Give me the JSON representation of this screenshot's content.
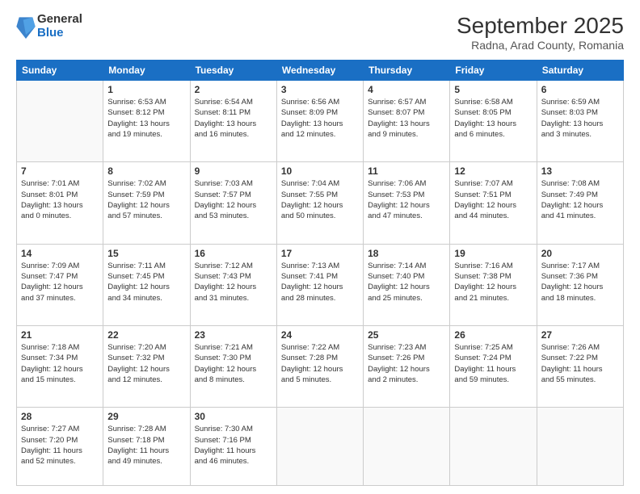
{
  "header": {
    "logo": {
      "general": "General",
      "blue": "Blue"
    },
    "title": "September 2025",
    "location": "Radna, Arad County, Romania"
  },
  "weekdays": [
    "Sunday",
    "Monday",
    "Tuesday",
    "Wednesday",
    "Thursday",
    "Friday",
    "Saturday"
  ],
  "weeks": [
    [
      {
        "day": "",
        "info": ""
      },
      {
        "day": "1",
        "info": "Sunrise: 6:53 AM\nSunset: 8:12 PM\nDaylight: 13 hours\nand 19 minutes."
      },
      {
        "day": "2",
        "info": "Sunrise: 6:54 AM\nSunset: 8:11 PM\nDaylight: 13 hours\nand 16 minutes."
      },
      {
        "day": "3",
        "info": "Sunrise: 6:56 AM\nSunset: 8:09 PM\nDaylight: 13 hours\nand 12 minutes."
      },
      {
        "day": "4",
        "info": "Sunrise: 6:57 AM\nSunset: 8:07 PM\nDaylight: 13 hours\nand 9 minutes."
      },
      {
        "day": "5",
        "info": "Sunrise: 6:58 AM\nSunset: 8:05 PM\nDaylight: 13 hours\nand 6 minutes."
      },
      {
        "day": "6",
        "info": "Sunrise: 6:59 AM\nSunset: 8:03 PM\nDaylight: 13 hours\nand 3 minutes."
      }
    ],
    [
      {
        "day": "7",
        "info": "Sunrise: 7:01 AM\nSunset: 8:01 PM\nDaylight: 13 hours\nand 0 minutes."
      },
      {
        "day": "8",
        "info": "Sunrise: 7:02 AM\nSunset: 7:59 PM\nDaylight: 12 hours\nand 57 minutes."
      },
      {
        "day": "9",
        "info": "Sunrise: 7:03 AM\nSunset: 7:57 PM\nDaylight: 12 hours\nand 53 minutes."
      },
      {
        "day": "10",
        "info": "Sunrise: 7:04 AM\nSunset: 7:55 PM\nDaylight: 12 hours\nand 50 minutes."
      },
      {
        "day": "11",
        "info": "Sunrise: 7:06 AM\nSunset: 7:53 PM\nDaylight: 12 hours\nand 47 minutes."
      },
      {
        "day": "12",
        "info": "Sunrise: 7:07 AM\nSunset: 7:51 PM\nDaylight: 12 hours\nand 44 minutes."
      },
      {
        "day": "13",
        "info": "Sunrise: 7:08 AM\nSunset: 7:49 PM\nDaylight: 12 hours\nand 41 minutes."
      }
    ],
    [
      {
        "day": "14",
        "info": "Sunrise: 7:09 AM\nSunset: 7:47 PM\nDaylight: 12 hours\nand 37 minutes."
      },
      {
        "day": "15",
        "info": "Sunrise: 7:11 AM\nSunset: 7:45 PM\nDaylight: 12 hours\nand 34 minutes."
      },
      {
        "day": "16",
        "info": "Sunrise: 7:12 AM\nSunset: 7:43 PM\nDaylight: 12 hours\nand 31 minutes."
      },
      {
        "day": "17",
        "info": "Sunrise: 7:13 AM\nSunset: 7:41 PM\nDaylight: 12 hours\nand 28 minutes."
      },
      {
        "day": "18",
        "info": "Sunrise: 7:14 AM\nSunset: 7:40 PM\nDaylight: 12 hours\nand 25 minutes."
      },
      {
        "day": "19",
        "info": "Sunrise: 7:16 AM\nSunset: 7:38 PM\nDaylight: 12 hours\nand 21 minutes."
      },
      {
        "day": "20",
        "info": "Sunrise: 7:17 AM\nSunset: 7:36 PM\nDaylight: 12 hours\nand 18 minutes."
      }
    ],
    [
      {
        "day": "21",
        "info": "Sunrise: 7:18 AM\nSunset: 7:34 PM\nDaylight: 12 hours\nand 15 minutes."
      },
      {
        "day": "22",
        "info": "Sunrise: 7:20 AM\nSunset: 7:32 PM\nDaylight: 12 hours\nand 12 minutes."
      },
      {
        "day": "23",
        "info": "Sunrise: 7:21 AM\nSunset: 7:30 PM\nDaylight: 12 hours\nand 8 minutes."
      },
      {
        "day": "24",
        "info": "Sunrise: 7:22 AM\nSunset: 7:28 PM\nDaylight: 12 hours\nand 5 minutes."
      },
      {
        "day": "25",
        "info": "Sunrise: 7:23 AM\nSunset: 7:26 PM\nDaylight: 12 hours\nand 2 minutes."
      },
      {
        "day": "26",
        "info": "Sunrise: 7:25 AM\nSunset: 7:24 PM\nDaylight: 11 hours\nand 59 minutes."
      },
      {
        "day": "27",
        "info": "Sunrise: 7:26 AM\nSunset: 7:22 PM\nDaylight: 11 hours\nand 55 minutes."
      }
    ],
    [
      {
        "day": "28",
        "info": "Sunrise: 7:27 AM\nSunset: 7:20 PM\nDaylight: 11 hours\nand 52 minutes."
      },
      {
        "day": "29",
        "info": "Sunrise: 7:28 AM\nSunset: 7:18 PM\nDaylight: 11 hours\nand 49 minutes."
      },
      {
        "day": "30",
        "info": "Sunrise: 7:30 AM\nSunset: 7:16 PM\nDaylight: 11 hours\nand 46 minutes."
      },
      {
        "day": "",
        "info": ""
      },
      {
        "day": "",
        "info": ""
      },
      {
        "day": "",
        "info": ""
      },
      {
        "day": "",
        "info": ""
      }
    ]
  ]
}
